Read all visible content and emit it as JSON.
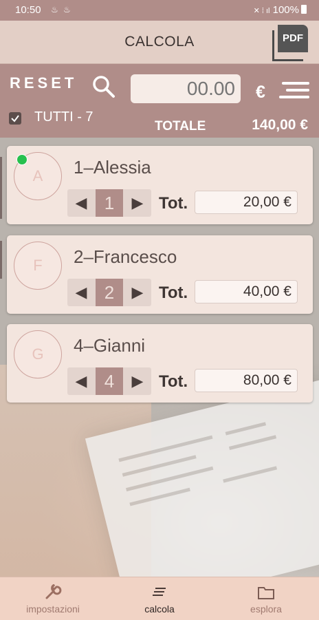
{
  "status_bar": {
    "time": "10:50",
    "battery": "100%"
  },
  "header": {
    "title": "CALCOLA",
    "pdf_label": "PDF"
  },
  "toolbar": {
    "reset_label": "RESET",
    "amount_placeholder": "00.00",
    "currency": "€",
    "select_all_label": "TUTTI - 7",
    "select_all_checked": true,
    "total_label": "TOTALE",
    "total_value": "140,00 €"
  },
  "people": [
    {
      "initial": "A",
      "name": "1–Alessia",
      "quantity": "1",
      "tot_label": "Tot.",
      "total": "20,00 €",
      "whatsapp": true
    },
    {
      "initial": "F",
      "name": "2–Francesco",
      "quantity": "2",
      "tot_label": "Tot.",
      "total": "40,00 €",
      "whatsapp": false
    },
    {
      "initial": "G",
      "name": "4–Gianni",
      "quantity": "4",
      "tot_label": "Tot.",
      "total": "80,00 €",
      "whatsapp": false
    }
  ],
  "bottom_nav": {
    "items": [
      {
        "label": "impostazioni",
        "icon": "wrench-icon",
        "active": false
      },
      {
        "label": "calcola",
        "icon": "list-icon",
        "active": true
      },
      {
        "label": "esplora",
        "icon": "folder-icon",
        "active": false
      }
    ]
  },
  "colors": {
    "accent": "#b08d89",
    "card": "#f3e5de",
    "appbar": "#e3cfc6",
    "bottom_nav": "#f1d3c5",
    "whatsapp": "#27c04e"
  }
}
